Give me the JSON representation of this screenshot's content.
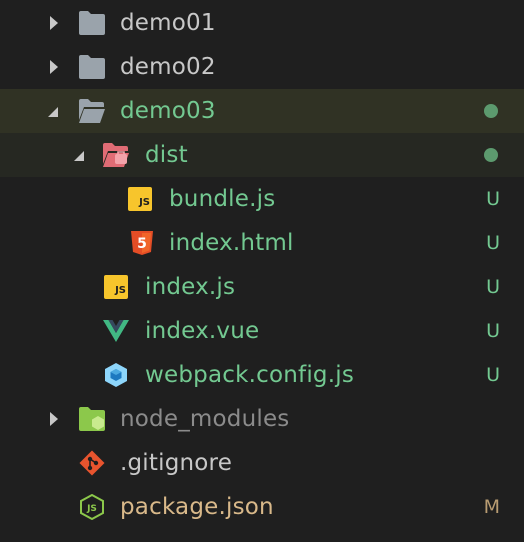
{
  "colors": {
    "background": "#1f1f1f",
    "folder_gray": "#9aa3ab",
    "default_text": "#c8c8c8",
    "untracked_green": "#73c991",
    "modified_tan": "#d9b98a",
    "ignored_gray": "#8b8b8b",
    "dist_folder": "#e06c75",
    "js_yellow": "#f7c52c",
    "html_orange": "#e44d26",
    "vue_green": "#41b883",
    "webpack_blue": "#8ed6fb",
    "git_red": "#e8542e",
    "node_green": "#8cc84b"
  },
  "tree": {
    "items": [
      {
        "label": "demo01",
        "icon": "folder-icon",
        "badge": "",
        "state": "collapsed"
      },
      {
        "label": "demo02",
        "icon": "folder-icon",
        "badge": "",
        "state": "collapsed"
      },
      {
        "label": "demo03",
        "icon": "folder-open-icon",
        "badge": "●",
        "state": "expanded"
      },
      {
        "label": "dist",
        "icon": "dist-folder-icon",
        "badge": "●",
        "state": "expanded"
      },
      {
        "label": "bundle.js",
        "icon": "js-file-icon",
        "badge": "U"
      },
      {
        "label": "index.html",
        "icon": "html5-file-icon",
        "badge": "U"
      },
      {
        "label": "index.js",
        "icon": "js-file-icon",
        "badge": "U"
      },
      {
        "label": "index.vue",
        "icon": "vue-file-icon",
        "badge": "U"
      },
      {
        "label": "webpack.config.js",
        "icon": "webpack-file-icon",
        "badge": "U"
      },
      {
        "label": "node_modules",
        "icon": "node-folder-icon",
        "badge": "",
        "state": "collapsed"
      },
      {
        "label": ".gitignore",
        "icon": "git-file-icon",
        "badge": ""
      },
      {
        "label": "package.json",
        "icon": "nodejs-file-icon",
        "badge": "M"
      }
    ]
  },
  "icon_text": {
    "js": "JS",
    "html5": "5"
  }
}
